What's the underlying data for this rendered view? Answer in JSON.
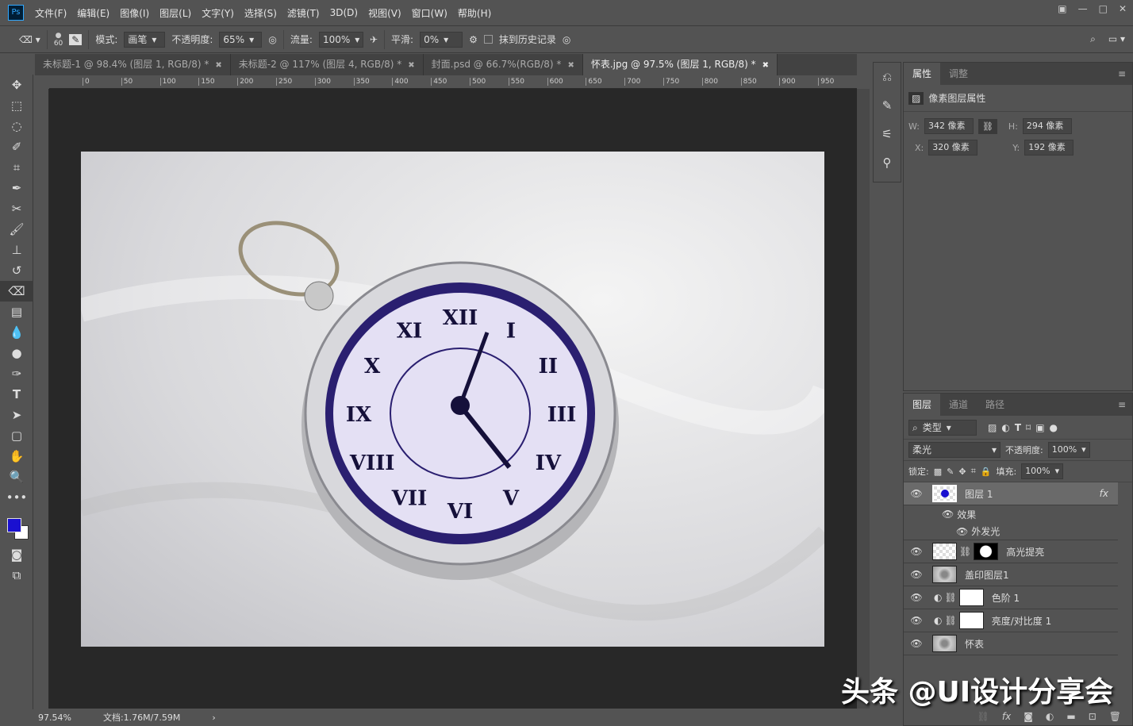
{
  "app": {
    "logo": "Ps"
  },
  "menu": [
    "文件(F)",
    "编辑(E)",
    "图像(I)",
    "图层(L)",
    "文字(Y)",
    "选择(S)",
    "滤镜(T)",
    "3D(D)",
    "视图(V)",
    "窗口(W)",
    "帮助(H)"
  ],
  "options": {
    "brush_size": "60",
    "mode_label": "模式:",
    "mode_value": "画笔",
    "opacity_label": "不透明度:",
    "opacity_value": "65%",
    "flow_label": "流量:",
    "flow_value": "100%",
    "smooth_label": "平滑:",
    "smooth_value": "0%",
    "erase_history_label": "抹到历史记录"
  },
  "tabs": [
    {
      "label": "未标题-1 @ 98.4% (图层 1, RGB/8) *"
    },
    {
      "label": "未标题-2 @ 117% (图层 4, RGB/8) *"
    },
    {
      "label": "封面.psd @ 66.7%(RGB/8) *"
    },
    {
      "label": "怀表.jpg @ 97.5% (图层 1, RGB/8) *"
    }
  ],
  "ruler_ticks": [
    "0",
    "50",
    "100",
    "150",
    "200",
    "250",
    "300",
    "350",
    "400",
    "450",
    "500",
    "550",
    "600",
    "650",
    "700",
    "750",
    "800",
    "850",
    "900",
    "950"
  ],
  "status": {
    "zoom": "97.54%",
    "doc": "文档:1.76M/7.59M"
  },
  "properties": {
    "tabs": [
      "属性",
      "调整"
    ],
    "title": "像素图层属性",
    "w_label": "W:",
    "w": "342 像素",
    "h_label": "H:",
    "h": "294 像素",
    "x_label": "X:",
    "x": "320 像素",
    "y_label": "Y:",
    "y": "192 像素"
  },
  "layers_panel": {
    "tabs": [
      "图层",
      "通道",
      "路径"
    ],
    "filter": "类型",
    "blend": "柔光",
    "opacity_label": "不透明度:",
    "opacity": "100%",
    "lock_label": "锁定:",
    "fill_label": "填充:",
    "fill": "100%",
    "layers": [
      {
        "name": "图层 1",
        "effects_label": "效果",
        "effect": "外发光",
        "fx": "fx"
      },
      {
        "name": "高光提亮"
      },
      {
        "name": "盖印图层1"
      },
      {
        "name": "色阶 1"
      },
      {
        "name": "亮度/对比度 1"
      },
      {
        "name": "怀表"
      }
    ]
  },
  "watermark": "头条 @UI设计分享会",
  "colors": {
    "foreground": "#1a10d0",
    "background": "#ffffff"
  }
}
